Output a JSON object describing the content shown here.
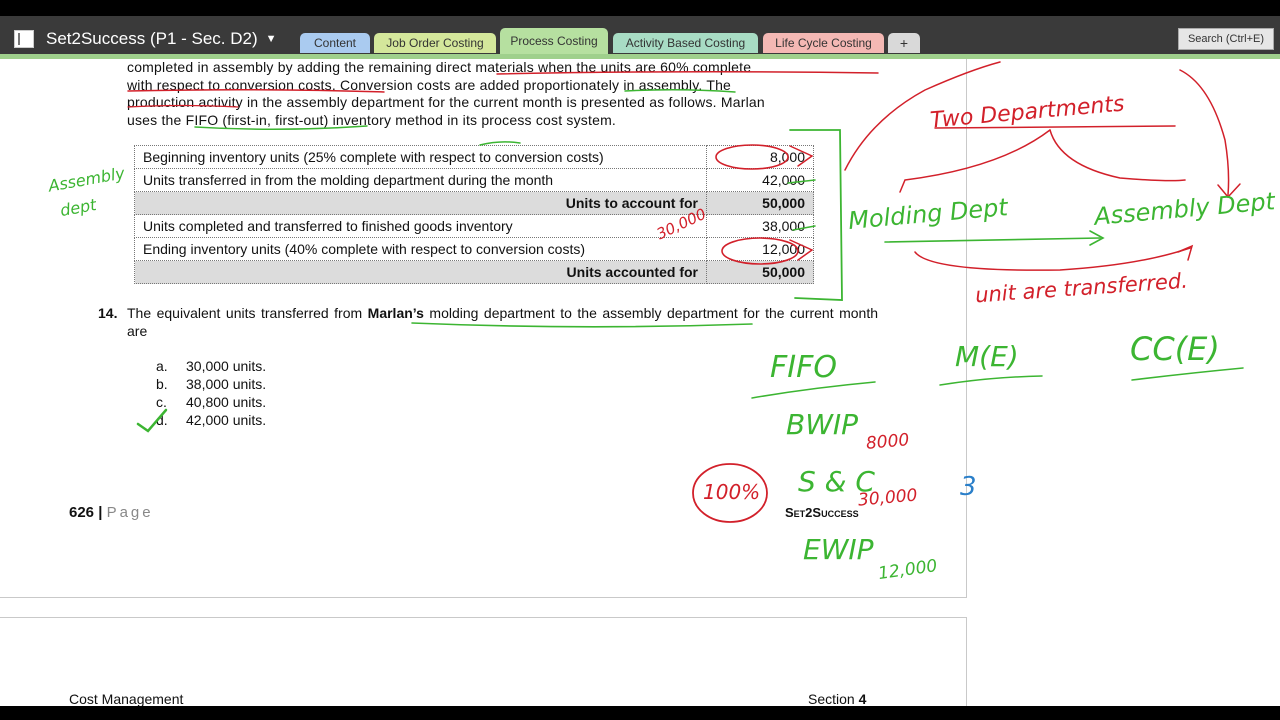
{
  "app": {
    "title": "Set2Success (P1 - Sec. D2)"
  },
  "tabs": [
    {
      "label": "Content",
      "color": "#aacbf0"
    },
    {
      "label": "Job Order Costing",
      "color": "#d4e79b"
    },
    {
      "label": "Process Costing",
      "color": "#b6e0a0"
    },
    {
      "label": "Activity Based Costing",
      "color": "#a8dcc4"
    },
    {
      "label": "Life Cycle Costing",
      "color": "#f4b8b4"
    },
    {
      "label": "+",
      "color": "#d9d9d9"
    }
  ],
  "search": {
    "label": "Search (Ctrl+E)"
  },
  "document": {
    "paragraph": [
      "completed in assembly by adding the remaining direct materials when the units are 60% complete",
      "with respect to conversion costs. Conversion costs are added proportionately in assembly. The",
      "production activity in the assembly department for the current month is presented as follows. Marlan",
      "uses the FIFO (first-in, first-out) inventory method in its process cost system."
    ],
    "table": [
      {
        "label": "Beginning inventory units (25% complete with respect to conversion costs)",
        "value": "8,000",
        "total": false
      },
      {
        "label": "Units transferred in from the molding department during the month",
        "value": "42,000",
        "total": false
      },
      {
        "label": "Units to account for",
        "value": "50,000",
        "total": true
      },
      {
        "label": "Units completed and transferred to finished goods inventory",
        "value": "38,000",
        "total": false
      },
      {
        "label": "Ending inventory units (40% complete with respect to conversion costs)",
        "value": "12,000",
        "total": false
      },
      {
        "label": "Units accounted for",
        "value": "50,000",
        "total": true
      }
    ],
    "question": {
      "number": "14.",
      "text_before": "The equivalent units transferred from ",
      "text_bold": "Marlan’s",
      "text_after": " molding department to the assembly department for the current month are"
    },
    "options": [
      {
        "letter": "a.",
        "text": "30,000 units."
      },
      {
        "letter": "b.",
        "text": "38,000 units."
      },
      {
        "letter": "c.",
        "text": "40,800 units."
      },
      {
        "letter": "d.",
        "text": "42,000 units."
      }
    ],
    "page_number": "626",
    "page_label": "Page",
    "brand": "Set2Success",
    "footer_left": "Cost Management",
    "footer_right_prefix": "Section",
    "footer_right_number": "4"
  },
  "annotations": {
    "two_departments": "Two Departments",
    "molding_dept": "Molding Dept",
    "assembly_dept": "Assembly Dept",
    "units_transferred": "unit are transferred.",
    "assembly_dept_side": [
      "Assembly",
      "dept"
    ],
    "fifo": "FIFO",
    "m_e": "M(E)",
    "cc_e": "CC(E)",
    "bwip": "BWIP",
    "bwip_val": "8000",
    "pct": "100%",
    "s_c": "S & C",
    "sc_val": "30,000",
    "ewip": "EWIP",
    "ewip_val": "12,000",
    "side_30000": "30,000",
    "three": "3"
  }
}
